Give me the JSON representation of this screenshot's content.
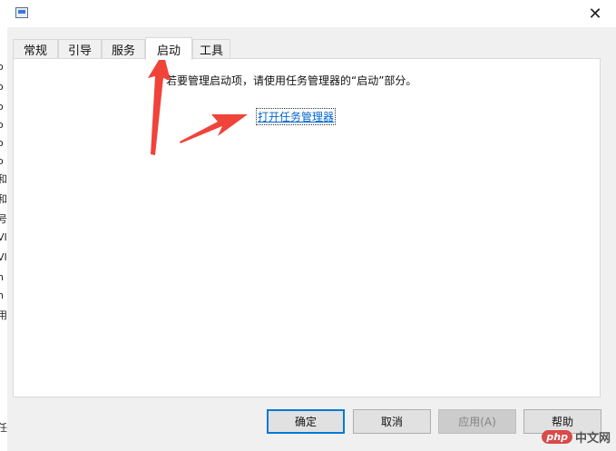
{
  "desktop_edge": {
    "fragments": [
      "o",
      "o",
      "o",
      "o",
      "o",
      "o",
      "和",
      "和",
      "号",
      "VI",
      "VI",
      "n",
      "n",
      "用",
      "任"
    ]
  },
  "window": {
    "close_glyph": "✕"
  },
  "tabs": [
    {
      "label": "常规",
      "active": false
    },
    {
      "label": "引导",
      "active": false
    },
    {
      "label": "服务",
      "active": false
    },
    {
      "label": "启动",
      "active": true
    },
    {
      "label": "工具",
      "active": false
    }
  ],
  "startup_panel": {
    "info_text": "若要管理启动项，请使用任务管理器的“启动”部分。",
    "open_task_manager_link": "打开任务管理器"
  },
  "buttons": {
    "ok": "确定",
    "cancel": "取消",
    "apply": "应用(A)",
    "help": "帮助"
  },
  "annotations": {
    "arrow_color": "#f0433a"
  },
  "watermark": {
    "badge": "php",
    "text": "中文网"
  }
}
